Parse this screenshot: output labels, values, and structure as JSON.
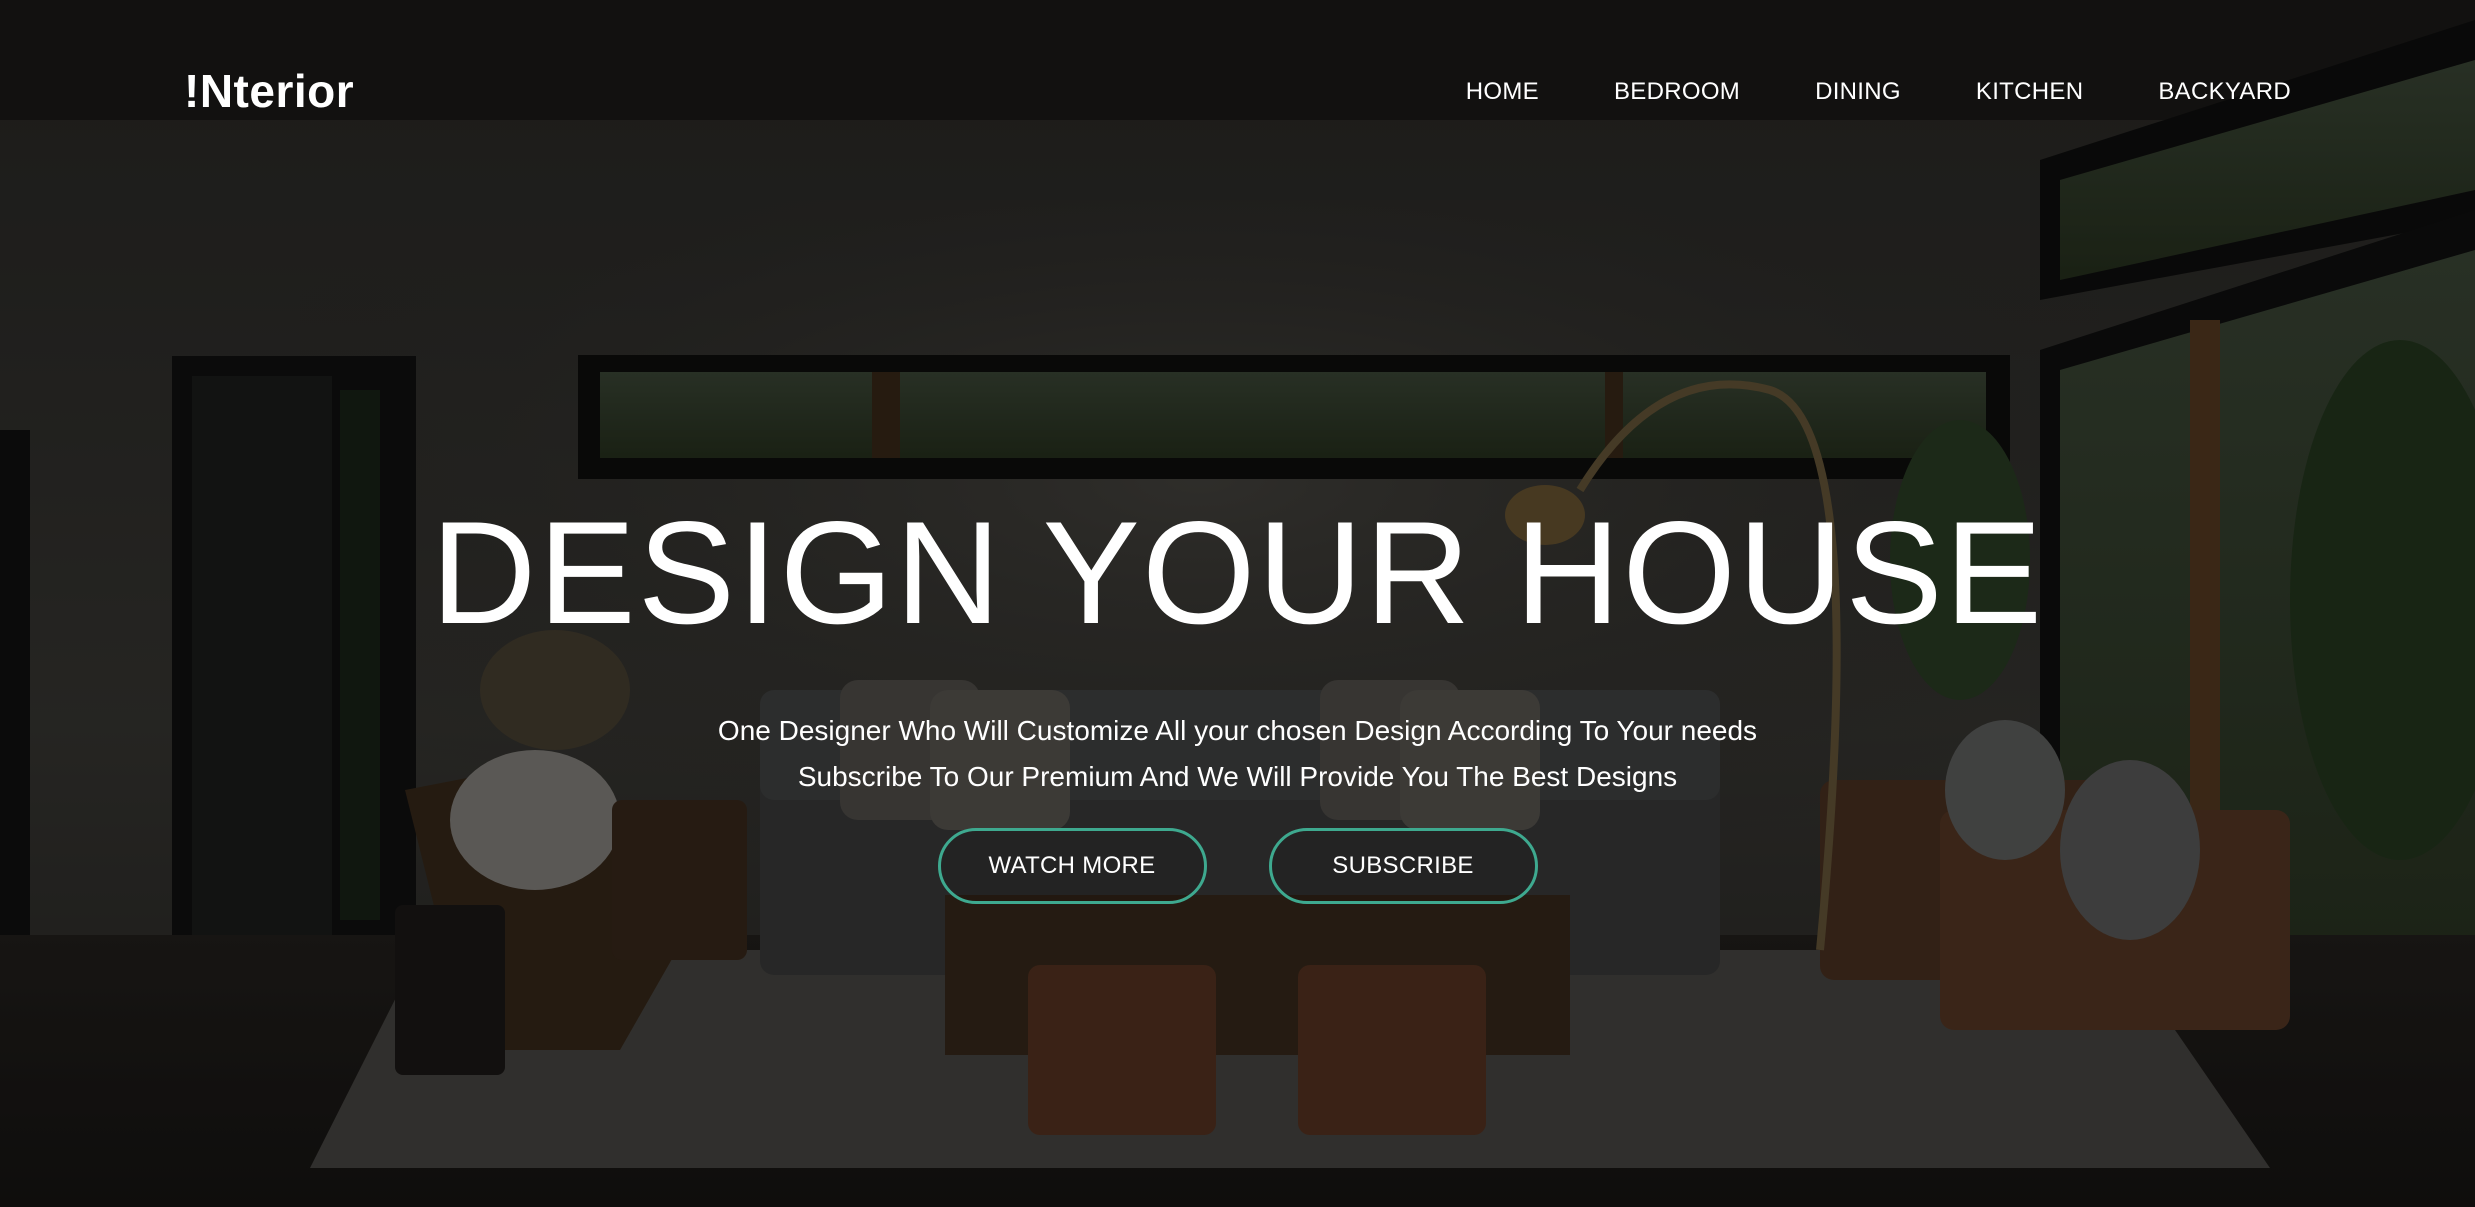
{
  "brand": {
    "logo": "!Nterior"
  },
  "nav": {
    "items": [
      {
        "label": "HOME"
      },
      {
        "label": "BEDROOM"
      },
      {
        "label": "DINING"
      },
      {
        "label": "KITCHEN"
      },
      {
        "label": "BACKYARD"
      }
    ]
  },
  "hero": {
    "title": "DESIGN YOUR HOUSE",
    "subtitle_line1": "One Designer Who Will Customize All your chosen Design According To Your needs",
    "subtitle_line2": "Subscribe To Our Premium And We Will Provide You The Best Designs",
    "watch_button": "WATCH MORE",
    "subscribe_button": "SUBSCRIBE"
  },
  "colors": {
    "accent": "#3ea98f",
    "text": "#ffffff"
  }
}
